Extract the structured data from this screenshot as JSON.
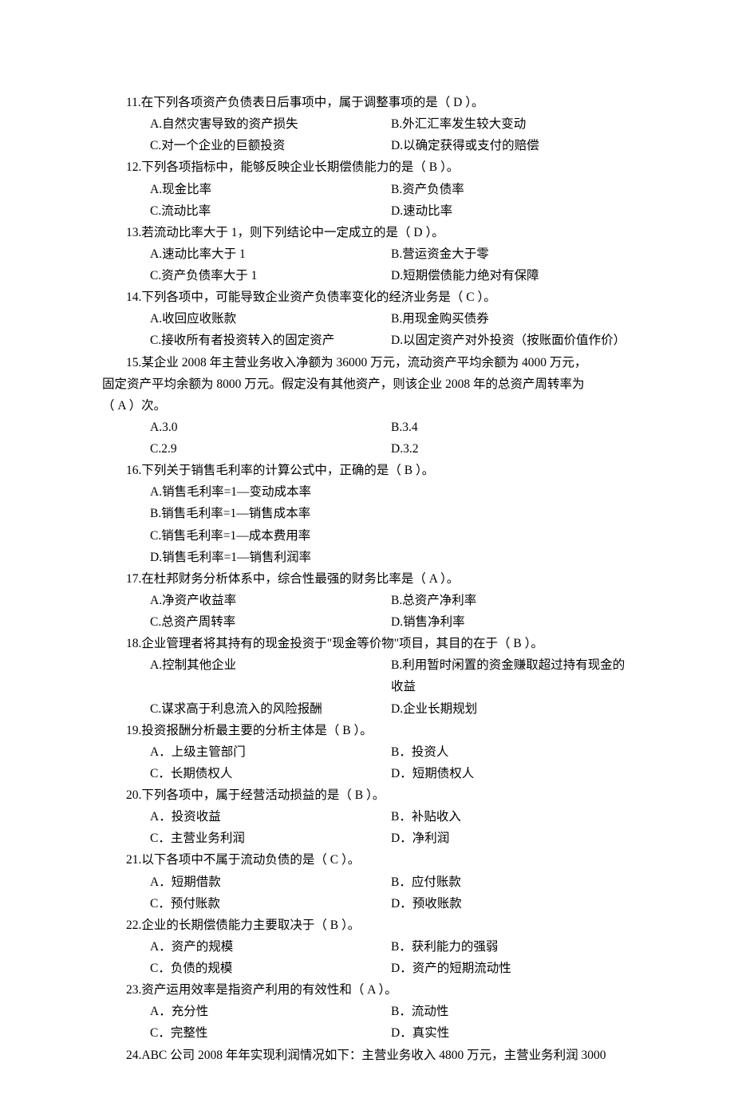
{
  "questions": [
    {
      "num": "11",
      "text": "在下列各项资产负债表日后事项中，属于调整事项的是（  D   ）。",
      "opts": [
        [
          "A.自然灾害导致的资产损失",
          "B.外汇汇率发生较大变动"
        ],
        [
          "C.对一个企业的巨额投资",
          "D.以确定获得或支付的赔偿"
        ]
      ]
    },
    {
      "num": "12",
      "text": "下列各项指标中，能够反映企业长期偿债能力的是（ B    ）。",
      "opts": [
        [
          "A.现金比率",
          "B.资产负债率"
        ],
        [
          "C.流动比率",
          "D.速动比率"
        ]
      ]
    },
    {
      "num": "13",
      "text": "若流动比率大于 1，则下列结论中一定成立的是（ D    ）。",
      "opts": [
        [
          "A.速动比率大于 1",
          "B.营运资金大于零"
        ],
        [
          "C.资产负债率大于 1",
          "D.短期偿债能力绝对有保障"
        ]
      ]
    },
    {
      "num": "14",
      "text": "下列各项中，可能导致企业资产负债率变化的经济业务是（  C   ）。",
      "opts": [
        [
          "A.收回应收账款",
          "B.用现金购买债券"
        ],
        [
          "C.接收所有者投资转入的固定资产",
          "D.以固定资产对外投资（按账面价值作价）"
        ]
      ]
    },
    {
      "num": "15",
      "text": "某企业 2008 年主营业务收入净额为 36000 万元，流动资产平均余额为 4000 万元，",
      "cont": [
        "固定资产平均余额为 8000 万元。假定没有其他资产，则该企业 2008 年的总资产周转率为",
        "（  A   ）次。"
      ],
      "opts": [
        [
          "A.3.0",
          "B.3.4"
        ],
        [
          "C.2.9",
          "D.3.2"
        ]
      ]
    },
    {
      "num": "16",
      "text": "下列关于销售毛利率的计算公式中，正确的是（   B   ）。",
      "single": [
        "A.销售毛利率=1—变动成本率",
        "B.销售毛利率=1—销售成本率",
        "C.销售毛利率=1—成本费用率",
        "D.销售毛利率=1—销售利润率"
      ]
    },
    {
      "num": "17",
      "text": "在杜邦财务分析体系中，综合性最强的财务比率是（  A    ）。",
      "opts": [
        [
          "A.净资产收益率",
          "B.总资产净利率"
        ],
        [
          "C.总资产周转率",
          "D.销售净利率"
        ]
      ]
    },
    {
      "num": "18",
      "text": "企业管理者将其持有的现金投资于\"现金等价物\"项目，其目的在于（  B   ）。",
      "opts": [
        [
          "A.控制其他企业",
          "B.利用暂时闲置的资金赚取超过持有现金的收益"
        ],
        [
          "C.谋求高于利息流入的风险报酬",
          "D.企业长期规划"
        ]
      ]
    },
    {
      "num": "19",
      "text": "投资报酬分析最主要的分析主体是（ B   ）。",
      "opts": [
        [
          "A．上级主管部门",
          "B．投资人"
        ],
        [
          "C．长期债权人",
          "D．短期债权人"
        ]
      ]
    },
    {
      "num": "20",
      "text": "下列各项中，属于经营活动损益的是（  B  ）。",
      "opts": [
        [
          "A．投资收益",
          "B．补贴收入"
        ],
        [
          "C．主营业务利润",
          "D．净利润"
        ]
      ]
    },
    {
      "num": "21",
      "text": "以下各项中不属于流动负债的是（  C   ）。",
      "opts": [
        [
          "A．短期借款",
          "B．应付账款"
        ],
        [
          "C．预付账款",
          "D．预收账款"
        ]
      ]
    },
    {
      "num": "22",
      "text": "企业的长期偿债能力主要取决于（ B   ）。",
      "opts": [
        [
          "A．资产的规模",
          "B．获利能力的强弱"
        ],
        [
          "C．负债的规模",
          "D．资产的短期流动性"
        ]
      ]
    },
    {
      "num": "23",
      "text": "资产运用效率是指资产利用的有效性和（  A  ）。",
      "opts": [
        [
          "A．充分性",
          "B．流动性"
        ],
        [
          "C．完整性",
          "D．真实性"
        ]
      ]
    },
    {
      "num": "24",
      "text": "ABC 公司 2008 年年实现利润情况如下：主营业务收入 4800 万元，主营业务利润 3000"
    }
  ]
}
